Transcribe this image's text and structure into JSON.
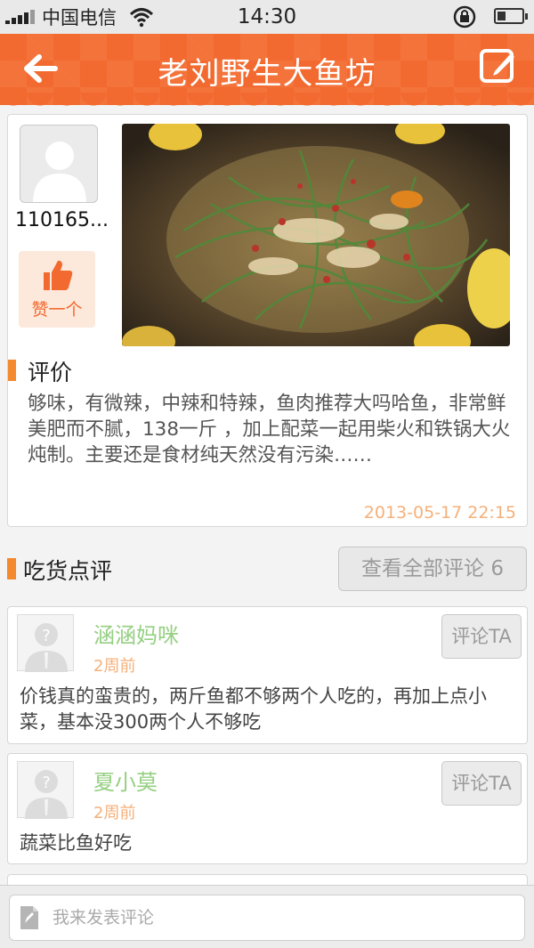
{
  "status_bar": {
    "carrier": "中国电信",
    "time": "14:30"
  },
  "header": {
    "title": "老刘野生大鱼坊"
  },
  "review": {
    "username": "110165...",
    "like_label": "赞一个",
    "section_title": "评价",
    "text": "够味，有微辣，中辣和特辣，鱼肉推荐大吗哈鱼，非常鲜美肥而不腻，138一斤 ，加上配菜一起用柴火和铁锅大火炖制。主要还是食材纯天然没有污染……",
    "date": "2013-05-17 22:15"
  },
  "comments_section": {
    "title": "吃货点评",
    "view_all_label": "查看全部评论 6"
  },
  "comments": [
    {
      "name": "涵涵妈咪",
      "when": "2周前",
      "reply_label": "评论TA",
      "text": "价钱真的蛮贵的，两斤鱼都不够两个人吃的，再加上点小菜，基本没300两个人不够吃"
    },
    {
      "name": "夏小莫",
      "when": "2周前",
      "reply_label": "评论TA",
      "text": "蔬菜比鱼好吃"
    }
  ],
  "bottom_bar": {
    "placeholder": "我来发表评论"
  },
  "colors": {
    "brand": "#f26a2f",
    "accent_bar": "#f5892e",
    "name_green": "#95cf82",
    "date_orange": "#f5b07a"
  }
}
